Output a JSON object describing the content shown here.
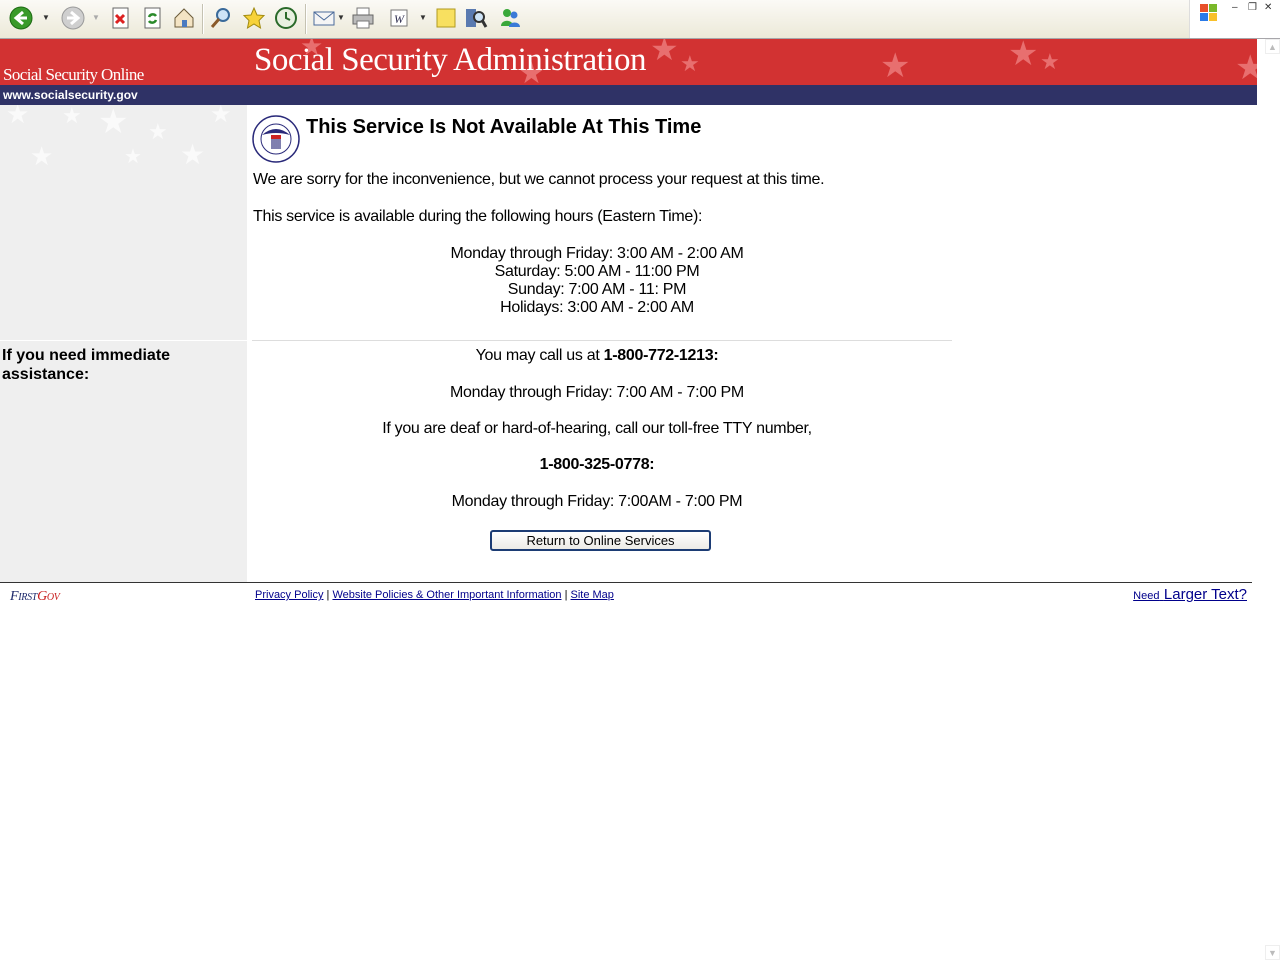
{
  "browser": {
    "toolbar_icons": [
      "back-icon",
      "forward-icon",
      "stop-icon",
      "refresh-icon",
      "home-icon",
      "search-icon",
      "favorites-icon",
      "history-icon",
      "mail-icon",
      "print-icon",
      "edit-icon",
      "notes-icon",
      "research-icon",
      "messenger-icon"
    ]
  },
  "header": {
    "site_online": "Social Security Online",
    "title": "Social Security Administration",
    "url": "www.socialsecurity.gov",
    "colors": {
      "red": "#d23232",
      "blue": "#2f3266"
    }
  },
  "main": {
    "heading": "This Service Is Not Available At This Time",
    "apology": "We are sorry for the inconvenience, but we cannot process your request at this time.",
    "hours_intro": "This service is available during the following hours (Eastern Time):",
    "hours": [
      "Monday through Friday: 3:00 AM - 2:00 AM",
      "Saturday: 5:00 AM - 11:00 PM",
      "Sunday: 7:00 AM - 11: PM",
      "Holidays: 3:00 AM - 2:00 AM"
    ],
    "call_prefix": "You may call us at ",
    "phone": "1-800-772-1213:",
    "phone_hours": "Monday through Friday: 7:00 AM - 7:00 PM",
    "tty_intro": "If you are deaf or hard-of-hearing, call our toll-free TTY number,",
    "tty_phone": "1-800-325-0778:",
    "tty_hours": "Monday through Friday: 7:00AM - 7:00 PM",
    "return_button": "Return to Online Services"
  },
  "sidebar": {
    "assist_label": "If you need immediate assistance:"
  },
  "footer": {
    "firstgov_first": "First",
    "firstgov_gov": "Gov",
    "links": [
      "Privacy Policy",
      "Website Policies & Other Important Information",
      "Site Map"
    ],
    "separator": "|",
    "need_small": "Need",
    "need_large": "Larger Text?"
  }
}
